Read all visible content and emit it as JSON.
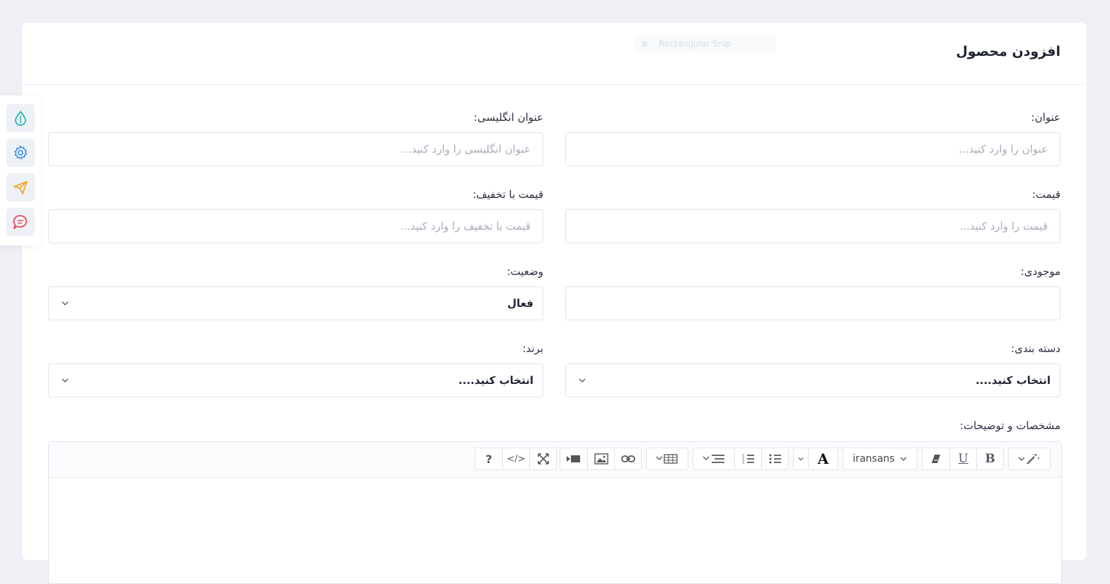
{
  "header": {
    "title": "افزودن محصول",
    "ghost_text": "Rectangular Snip"
  },
  "form": {
    "title": {
      "label": "عنوان:",
      "placeholder": "عنوان را وارد کنید..."
    },
    "title_en": {
      "label": "عنوان انگلیسی:",
      "placeholder": "عنوان انگلیسی را وارد کنید..."
    },
    "price": {
      "label": "قیمت:",
      "placeholder": "قیمت را وارد کنید..."
    },
    "discount_price": {
      "label": "قیمت با تخفیف:",
      "placeholder": "قیمت با تخفیف را وارد کنید..."
    },
    "stock": {
      "label": "موجودی:",
      "value": ""
    },
    "status": {
      "label": "وضعیت:",
      "selected": "فعال"
    },
    "category": {
      "label": "دسته بندی:",
      "selected": "انتخاب کنید...."
    },
    "brand": {
      "label": "برند:",
      "selected": "انتخاب کنید...."
    },
    "description": {
      "label": "مشخصات و توضیحات:"
    }
  },
  "toolbar": {
    "font_name": "iransans",
    "help_label": "?",
    "code_label": "</>"
  },
  "sidebar": {
    "icons": [
      "droplet-icon",
      "gear-icon",
      "send-icon",
      "chat-icon"
    ]
  },
  "colors": {
    "accent_teal": "#22b8b0",
    "accent_blue": "#2d8cf0",
    "accent_orange": "#f5a623",
    "accent_red": "#e8455a"
  }
}
